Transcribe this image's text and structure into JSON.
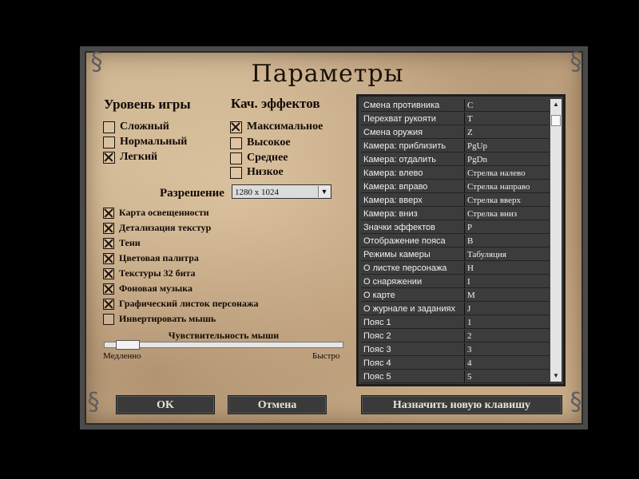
{
  "title": "Параметры",
  "game_level": {
    "heading": "Уровень игры",
    "options": [
      {
        "label": "Сложный",
        "checked": false
      },
      {
        "label": "Нормальный",
        "checked": false
      },
      {
        "label": "Легкий",
        "checked": true
      }
    ]
  },
  "effects_quality": {
    "heading": "Кач. эффектов",
    "options": [
      {
        "label": "Максимальное",
        "checked": true
      },
      {
        "label": "Высокое",
        "checked": false
      },
      {
        "label": "Среднее",
        "checked": false
      },
      {
        "label": "Низкое",
        "checked": false
      }
    ]
  },
  "resolution": {
    "label": "Разрешение",
    "value": "1280 x 1024"
  },
  "toggles": [
    {
      "label": "Карта освещенности",
      "checked": true
    },
    {
      "label": "Детализация текстур",
      "checked": true
    },
    {
      "label": "Тени",
      "checked": true
    },
    {
      "label": "Цветовая палитра",
      "checked": true
    },
    {
      "label": "Текстуры 32 бита",
      "checked": true
    },
    {
      "label": "Фоновая музыка",
      "checked": true
    },
    {
      "label": "Графический листок персонажа",
      "checked": true
    },
    {
      "label": "Инвертировать мышь",
      "checked": false
    }
  ],
  "mouse": {
    "label": "Чувствительность мыши",
    "min_label": "Медленно",
    "max_label": "Быстро",
    "value": 0.05
  },
  "keybindings": [
    {
      "action": "Смена противника",
      "key": "C"
    },
    {
      "action": "Перехват рукояти",
      "key": "T"
    },
    {
      "action": "Смена оружия",
      "key": "Z"
    },
    {
      "action": "Камера: приблизить",
      "key": "PgUp"
    },
    {
      "action": "Камера: отдалить",
      "key": "PgDn"
    },
    {
      "action": "Камера: влево",
      "key": "Стрелка налево"
    },
    {
      "action": "Камера: вправо",
      "key": "Стрелка направо"
    },
    {
      "action": "Камера: вверх",
      "key": "Стрелка вверх"
    },
    {
      "action": "Камера: вниз",
      "key": "Стрелка вниз"
    },
    {
      "action": "Значки эффектов",
      "key": "P"
    },
    {
      "action": "Отображение пояса",
      "key": "B"
    },
    {
      "action": "Режимы камеры",
      "key": "Табуляция"
    },
    {
      "action": "О листке персонажа",
      "key": "H"
    },
    {
      "action": "О снаряжении",
      "key": "I"
    },
    {
      "action": "О карте",
      "key": "M"
    },
    {
      "action": "О журнале и заданиях",
      "key": "J"
    },
    {
      "action": "Пояс 1",
      "key": "1"
    },
    {
      "action": "Пояс 2",
      "key": "2"
    },
    {
      "action": "Пояс 3",
      "key": "3"
    },
    {
      "action": "Пояс 4",
      "key": "4"
    },
    {
      "action": "Пояс 5",
      "key": "5"
    }
  ],
  "buttons": {
    "ok": "OK",
    "cancel": "Отмена",
    "assign_key": "Назначить новую клавишу"
  },
  "icons": {
    "corner": "dragon-ornament-icon",
    "dropdown": "chevron-down-icon",
    "scroll_up": "arrow-up-icon",
    "scroll_down": "arrow-down-icon"
  }
}
